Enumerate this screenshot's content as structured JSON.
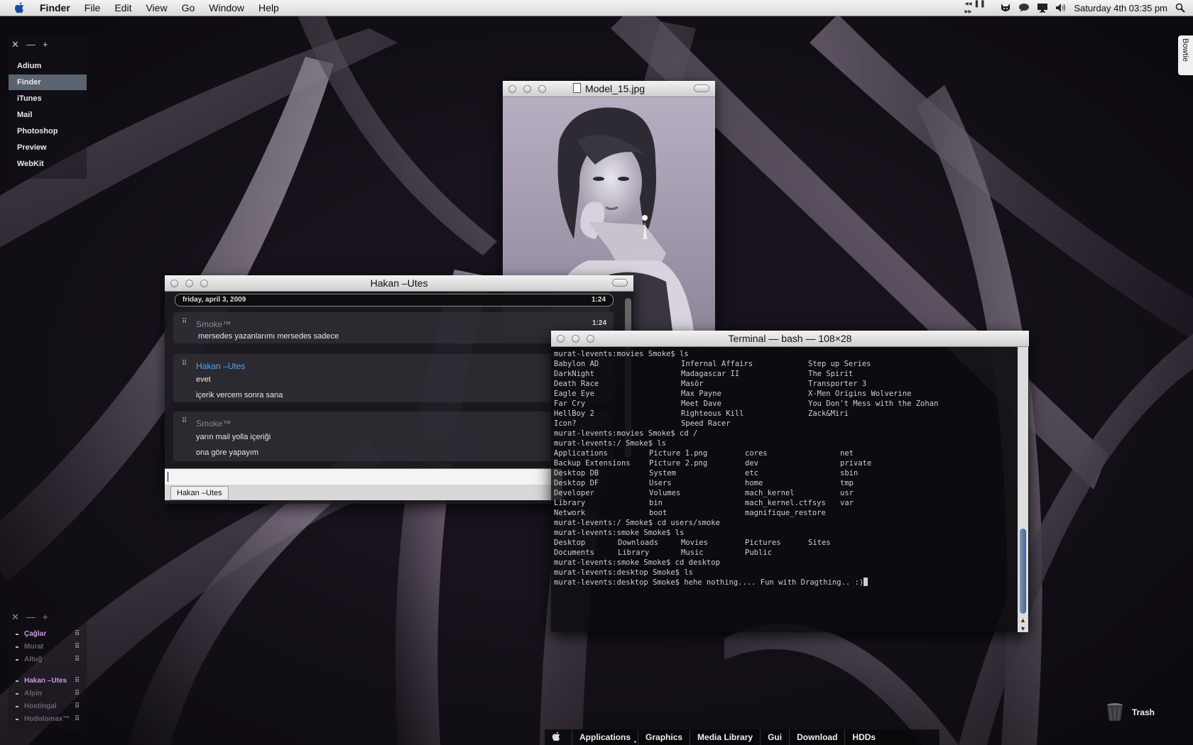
{
  "menubar": {
    "apple": "apple-icon",
    "app": "Finder",
    "menus": [
      "File",
      "Edit",
      "View",
      "Go",
      "Window",
      "Help"
    ],
    "status_icons": [
      "playback-controls-icon",
      "cat-icon",
      "speech-bubble-icon",
      "display-icon",
      "volume-icon"
    ],
    "clock": "Saturday 4th  03:35 pm",
    "search": "spotlight-icon"
  },
  "launcher": {
    "controls": [
      "✕",
      "—",
      "+"
    ],
    "items": [
      "Adium",
      "Finder",
      "iTunes",
      "Mail",
      "Photoshop",
      "Preview",
      "WebKit"
    ],
    "active": "Finder"
  },
  "buddies": {
    "controls": [
      "✕",
      "—",
      "+"
    ],
    "items": [
      {
        "name": "Çağlar",
        "color": "#c99be0"
      },
      {
        "name": "Murat",
        "color": "#6a6070"
      },
      {
        "name": "Altuğ",
        "color": "#6a6070"
      },
      {
        "name": "Hakan –Utes",
        "color": "#c99be0"
      },
      {
        "name": "Alpin",
        "color": "#6a6070"
      },
      {
        "name": "Hostingal",
        "color": "#6a6070"
      },
      {
        "name": "Hodolomax™",
        "color": "#6a6070"
      }
    ]
  },
  "image_window": {
    "title": "Model_15.jpg",
    "icon": "image-file-icon"
  },
  "chat": {
    "title": "Hakan –Utes",
    "date": "friday, april 3, 2009",
    "date_time": "1:24",
    "messages": [
      {
        "sender": "Smoke™",
        "sender_color": "#8a8a8a",
        "time": "1:24",
        "lines": [
          "mersedes yazanlarımı mersedes sadece"
        ]
      },
      {
        "sender": "Hakan –Utes",
        "sender_color": "#5ea4e8",
        "time": "",
        "lines": [
          "evet",
          "içerik vercem sonra sana"
        ]
      },
      {
        "sender": "Smoke™",
        "sender_color": "#8a8a8a",
        "time": "",
        "lines": [
          "yarın mail yolla içeriği",
          "ona göre yapayım"
        ]
      }
    ],
    "input_value": "",
    "tab": "Hakan –Utes"
  },
  "terminal": {
    "title": "Terminal — bash — 108×28",
    "lines": [
      "murat-levents:movies Smoke$ ls",
      {
        "cols": [
          "Babylon AD",
          "Infernal Affairs",
          "Step up Series"
        ]
      },
      {
        "cols": [
          "DarkNight",
          "Madagascar II",
          "The Spirit"
        ]
      },
      {
        "cols": [
          "Death Race",
          "Masör",
          "Transporter 3"
        ]
      },
      {
        "cols": [
          "Eagle Eye",
          "Max Payne",
          "X-Men Origins Wolverine"
        ]
      },
      {
        "cols": [
          "Far Cry",
          "Meet Dave",
          "You Don't Mess with the Zohan"
        ]
      },
      {
        "cols": [
          "HellBoy 2",
          "Righteous Kill",
          "Zack&Miri"
        ]
      },
      {
        "cols": [
          "Icon?",
          "Speed Racer",
          ""
        ]
      },
      "murat-levents:movies Smoke$ cd /",
      "murat-levents:/ Smoke$ ls",
      {
        "cols4": [
          "Applications",
          "Picture 1.png",
          "cores",
          "net"
        ]
      },
      {
        "cols4": [
          "Backup Extensions",
          "Picture 2.png",
          "dev",
          "private"
        ]
      },
      {
        "cols4": [
          "Desktop DB",
          "System",
          "etc",
          "sbin"
        ]
      },
      {
        "cols4": [
          "Desktop DF",
          "Users",
          "home",
          "tmp"
        ]
      },
      {
        "cols4": [
          "Developer",
          "Volumes",
          "mach_kernel",
          "usr"
        ]
      },
      {
        "cols4": [
          "Library",
          "bin",
          "mach_kernel.ctfsys",
          "var"
        ]
      },
      {
        "cols4": [
          "Network",
          "boot",
          "magnifique_restore",
          ""
        ]
      },
      "murat-levents:/ Smoke$ cd users/smoke",
      "murat-levents:smoke Smoke$ ls",
      {
        "cols5": [
          "Desktop",
          "Downloads",
          "Movies",
          "Pictures",
          "Sites"
        ]
      },
      {
        "cols5": [
          "Documents",
          "Library",
          "Music",
          "Public",
          ""
        ]
      },
      "murat-levents:smoke Smoke$ cd desktop",
      "murat-levents:desktop Smoke$ ls",
      "murat-levents:desktop Smoke$ hehe nothing.... Fun with Dragthing.. :)"
    ]
  },
  "bowtie": "Bowtie",
  "trash": "Trash",
  "dock": {
    "items": [
      {
        "label": "",
        "icon": "apple-icon"
      },
      {
        "label": "Applications",
        "running": true
      },
      {
        "label": "Graphics"
      },
      {
        "label": "Media Library"
      },
      {
        "label": "Gui"
      },
      {
        "label": "Download"
      },
      {
        "label": "HDDs"
      }
    ]
  },
  "colors": {
    "accent": "#5ea4e8",
    "buddy_online": "#c99be0",
    "menubar": "#e8e8e8"
  }
}
